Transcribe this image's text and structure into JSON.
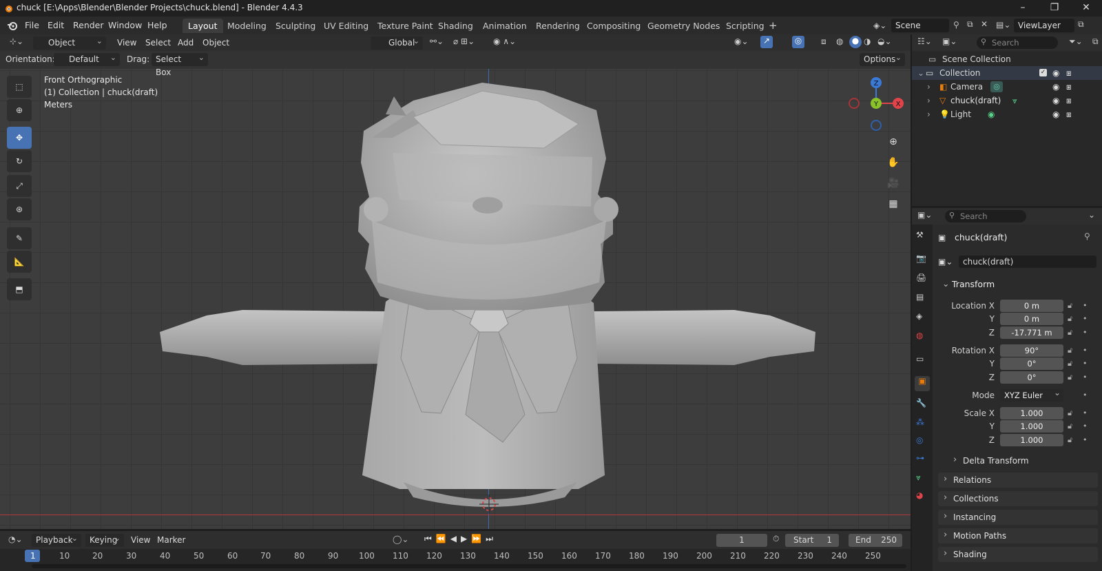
{
  "window": {
    "title": "chuck [E:\\Apps\\Blender\\Blender Projects\\chuck.blend] - Blender 4.4.3",
    "controls": [
      "–",
      "❐",
      "✕"
    ]
  },
  "menu": {
    "items": [
      "File",
      "Edit",
      "Render",
      "Window",
      "Help"
    ],
    "workspaces": [
      "Layout",
      "Modeling",
      "Sculpting",
      "UV Editing",
      "Texture Paint",
      "Shading",
      "Animation",
      "Rendering",
      "Compositing",
      "Geometry Nodes",
      "Scripting"
    ],
    "add_workspace": "+",
    "scene": "Scene",
    "view_layer": "ViewLayer"
  },
  "viewport_header": {
    "mode": "Object Mode",
    "menus": [
      "View",
      "Select",
      "Add",
      "Object"
    ],
    "transform_orientation": "Global"
  },
  "tool_settings": {
    "orientation_label": "Orientation:",
    "orientation_value": "Default",
    "drag_label": "Drag:",
    "drag_value": "Select Box",
    "options": "Options"
  },
  "viewport_info": {
    "view_name": "Front Orthographic",
    "collection_line": "(1) Collection | chuck(draft)",
    "units": "Meters"
  },
  "gizmo": {
    "z": "Z",
    "y": "Y",
    "x": "X"
  },
  "outliner": {
    "search_placeholder": "Search",
    "scene_collection": "Scene Collection",
    "collection": "Collection",
    "objects": [
      "Camera",
      "chuck(draft)",
      "Light"
    ]
  },
  "properties": {
    "search_placeholder": "Search",
    "object_name": "chuck(draft)",
    "data_name": "chuck(draft)",
    "transform_title": "Transform",
    "location_labels": [
      "Location X",
      "Y",
      "Z"
    ],
    "location_values": [
      "0 m",
      "0 m",
      "-17.771 m"
    ],
    "rotation_labels": [
      "Rotation X",
      "Y",
      "Z"
    ],
    "rotation_values": [
      "90°",
      "0°",
      "0°"
    ],
    "mode_label": "Mode",
    "mode_value": "XYZ Euler",
    "scale_labels": [
      "Scale X",
      "Y",
      "Z"
    ],
    "scale_values": [
      "1.000",
      "1.000",
      "1.000"
    ],
    "subpanels": [
      "Delta Transform",
      "Relations",
      "Collections",
      "Instancing",
      "Motion Paths",
      "Shading"
    ]
  },
  "timeline": {
    "menus": [
      "Playback",
      "Keying",
      "View",
      "Marker"
    ],
    "current_frame": "1",
    "start_label": "Start",
    "start_value": "1",
    "end_label": "End",
    "end_value": "250",
    "frame_marks": [
      "1",
      "10",
      "20",
      "30",
      "40",
      "50",
      "60",
      "70",
      "80",
      "90",
      "100",
      "110",
      "120",
      "130",
      "140",
      "150",
      "160",
      "170",
      "180",
      "190",
      "200",
      "210",
      "220",
      "230",
      "240",
      "250"
    ]
  },
  "colors": {
    "accent": "#4772b3",
    "x_axis": "#e0444a",
    "y_axis": "#8ac22a",
    "z_axis": "#3b79d6",
    "orange_selection": "#e87d0d"
  }
}
